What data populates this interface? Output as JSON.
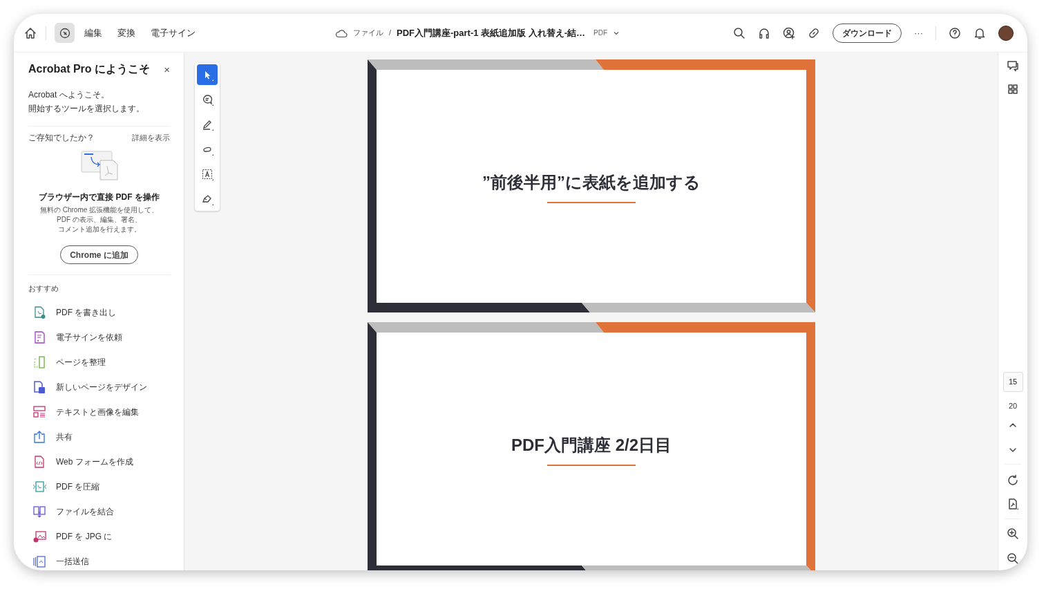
{
  "top_bar": {
    "modes": [
      {
        "kind": "icon",
        "selected": true
      },
      {
        "kind": "text",
        "label": "編集",
        "selected": false
      },
      {
        "kind": "text",
        "label": "変換",
        "selected": false
      },
      {
        "kind": "text",
        "label": "電子サイン",
        "selected": false
      }
    ],
    "breadcrumb": {
      "root": "ファイル",
      "separator": "/",
      "file_name": "PDF入門講座-part-1 表紙追加版 入れ替え-結…",
      "file_type": "PDF"
    },
    "download_button": "ダウンロード",
    "more": "···"
  },
  "welcome_panel": {
    "title": "Acrobat Pro にようこそ",
    "close": "×",
    "intro": [
      "Acrobat へようこそ。",
      "開始するツールを選択します。"
    ],
    "tip_label": "ご存知でしたか？",
    "tip_link": "詳細を表示",
    "promo_title": "ブラウザー内で直接 PDF を操作",
    "promo_text": [
      "無料の Chrome 拡張機能を使用して、",
      "PDF の表示、編集、署名、",
      "コメント追加を行えます。"
    ],
    "promo_button": "Chrome に追加",
    "section_label": "おすすめ",
    "tools": [
      {
        "label": "PDF を書き出し"
      },
      {
        "label": "電子サインを依頼"
      },
      {
        "label": "ページを整理"
      },
      {
        "label": "新しいページをデザイン"
      },
      {
        "label": "テキストと画像を編集"
      },
      {
        "label": "共有"
      },
      {
        "label": "Web フォームを作成"
      },
      {
        "label": "PDF を圧縮"
      },
      {
        "label": "ファイルを結合"
      },
      {
        "label": "PDF を JPG に"
      },
      {
        "label": "一括送信"
      }
    ]
  },
  "annotation_tools": [
    {
      "selected": true
    },
    {
      "selected": false
    },
    {
      "selected": false
    },
    {
      "selected": false
    },
    {
      "selected": false
    },
    {
      "selected": false
    }
  ],
  "pages": [
    {
      "title": "”前後半用”に表紙を追加する"
    },
    {
      "title": "PDF入門講座 2/2日目"
    }
  ],
  "right_rail": {
    "current_page": "15",
    "total_pages": "20"
  }
}
